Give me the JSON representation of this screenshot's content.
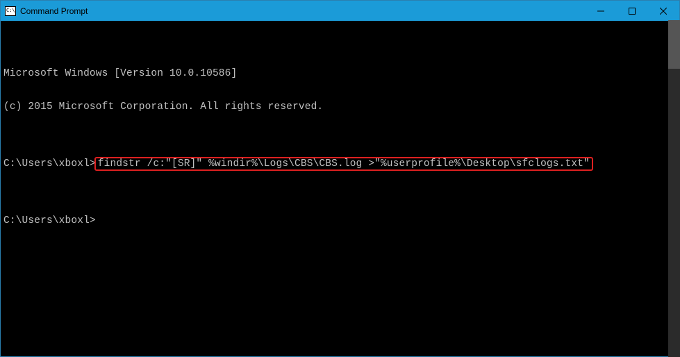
{
  "titlebar": {
    "icon_text": "C:\\",
    "title": "Command Prompt"
  },
  "terminal": {
    "line1": "Microsoft Windows [Version 10.0.10586]",
    "line2": "(c) 2015 Microsoft Corporation. All rights reserved.",
    "blank": "",
    "prompt1_prefix": "C:\\Users\\xboxl>",
    "command": "findstr /c:\"[SR]\" %windir%\\Logs\\CBS\\CBS.log >\"%userprofile%\\Desktop\\sfclogs.txt\"",
    "prompt2": "C:\\Users\\xboxl>"
  }
}
